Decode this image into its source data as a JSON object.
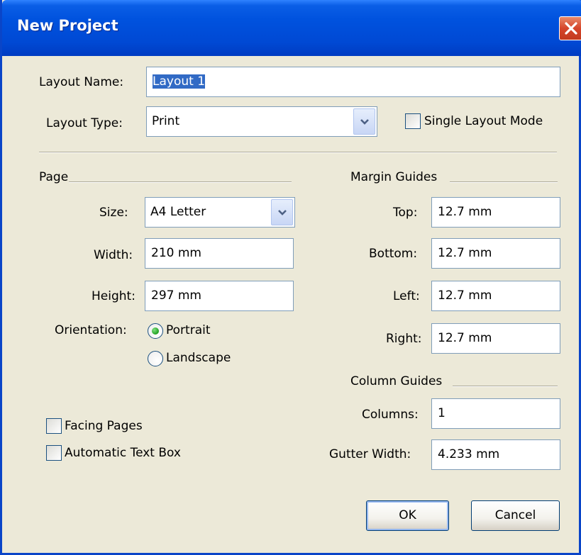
{
  "window": {
    "title": "New Project"
  },
  "layout": {
    "name_label": "Layout Name:",
    "name_value": "Layout 1",
    "type_label": "Layout Type:",
    "type_value": "Print",
    "single_mode_label": "Single Layout Mode",
    "single_mode_checked": false
  },
  "page": {
    "group_label": "Page",
    "size_label": "Size:",
    "size_value": "A4 Letter",
    "width_label": "Width:",
    "width_value": "210 mm",
    "height_label": "Height:",
    "height_value": "297 mm",
    "orientation_label": "Orientation:",
    "portrait_label": "Portrait",
    "landscape_label": "Landscape",
    "orientation_selected": "Portrait"
  },
  "margin_guides": {
    "group_label": "Margin Guides",
    "top_label": "Top:",
    "top_value": "12.7 mm",
    "bottom_label": "Bottom:",
    "bottom_value": "12.7 mm",
    "left_label": "Left:",
    "left_value": "12.7 mm",
    "right_label": "Right:",
    "right_value": "12.7 mm"
  },
  "column_guides": {
    "group_label": "Column Guides",
    "columns_label": "Columns:",
    "columns_value": "1",
    "gutter_label": "Gutter Width:",
    "gutter_value": "4.233 mm"
  },
  "options": {
    "facing_pages_label": "Facing Pages",
    "facing_pages_checked": false,
    "auto_text_box_label": "Automatic Text Box",
    "auto_text_box_checked": false
  },
  "buttons": {
    "ok_label": "OK",
    "cancel_label": "Cancel"
  },
  "colors": {
    "titlebar": "#0052de",
    "dialog_bg": "#ece9d8",
    "field_border": "#7f9db9",
    "selection": "#316ac5"
  }
}
